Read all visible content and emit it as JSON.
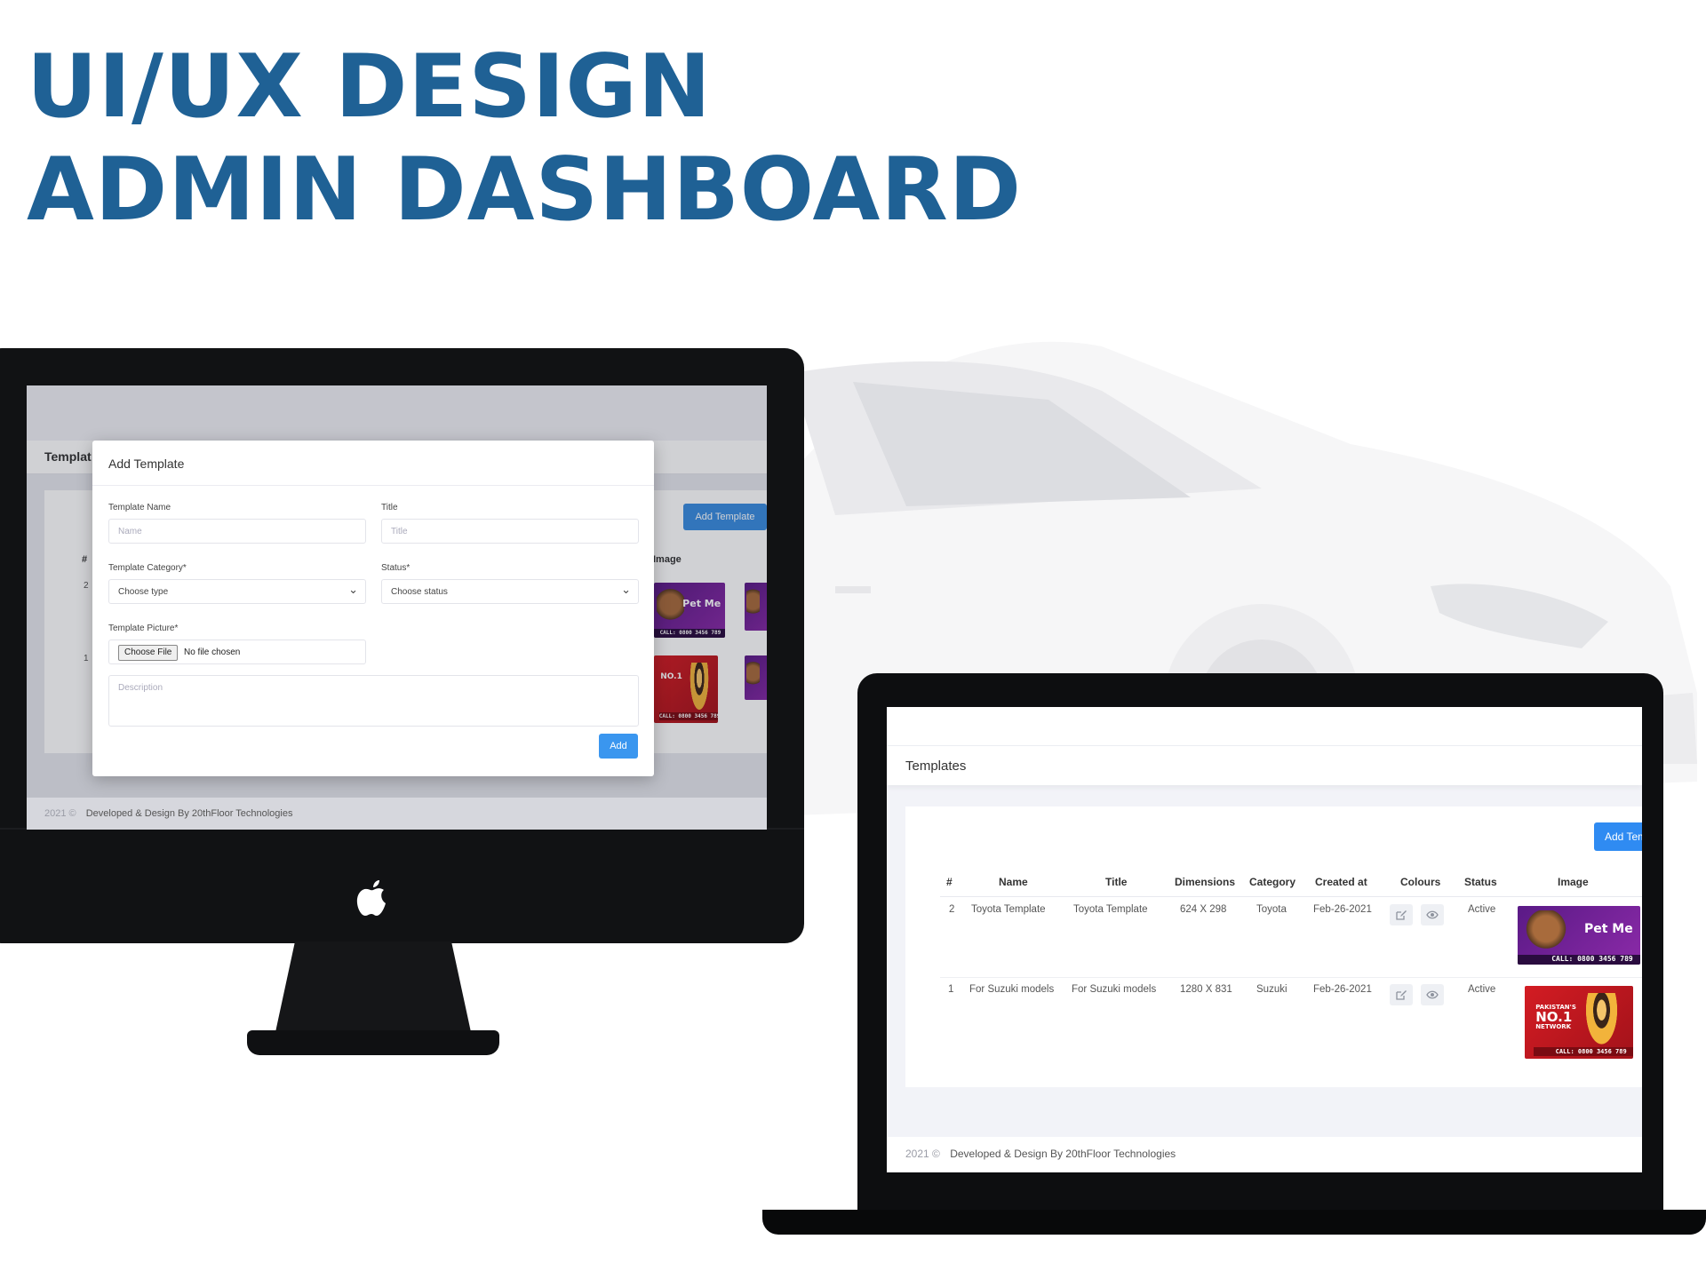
{
  "headline": {
    "line1": "UI/UX DESIGN",
    "line2": "ADMIN DASHBOARD"
  },
  "colors": {
    "headline": "#1f6195",
    "primary_button": "#3a96ef",
    "sidebar": "#23262f"
  },
  "monitor": {
    "page_title": "Templat",
    "add_template_label": "Add Template",
    "table_image_header": "Image",
    "table_hash_header": "#",
    "row_numbers": [
      "2",
      "1"
    ],
    "footer_year": "2021 ©",
    "footer_text": "Developed & Design By 20thFloor Technologies",
    "modal": {
      "title": "Add Template",
      "template_name_label": "Template Name",
      "template_name_placeholder": "Name",
      "title_label": "Title",
      "title_placeholder": "Title",
      "category_label": "Template Category*",
      "category_value": "Choose type",
      "status_label": "Status*",
      "status_value": "Choose status",
      "picture_label": "Template Picture*",
      "choose_file_label": "Choose File",
      "no_file_text": "No file chosen",
      "description_placeholder": "Description",
      "add_button": "Add"
    }
  },
  "laptop": {
    "page_title": "Templates",
    "add_button": "Add Template",
    "columns": [
      "#",
      "Name",
      "Title",
      "Dimensions",
      "Category",
      "Created at",
      "Colours",
      "Status",
      "Image"
    ],
    "rows": [
      {
        "id": "2",
        "name": "Toyota Template",
        "title": "Toyota Template",
        "dimensions": "624 X 298",
        "category": "Toyota",
        "created_at": "Feb-26-2021",
        "status": "Active",
        "image": "pet-me-ad"
      },
      {
        "id": "1",
        "name": "For Suzuki models",
        "title": "For Suzuki models",
        "dimensions": "1280 X 831",
        "category": "Suzuki",
        "created_at": "Feb-26-2021",
        "status": "Active",
        "image": "jazz-no1-network-ad"
      }
    ],
    "footer_year": "2021 ©",
    "footer_text": "Developed & Design By 20thFloor Technologies"
  },
  "ad_images": {
    "pet_me": {
      "brand": "Pet Me",
      "phone": "CALL: 0800 3456 789"
    },
    "jazz": {
      "line1": "PAKISTAN'S",
      "line2": "NO.1",
      "line3": "NETWORK",
      "phone": "CALL: 0800 3456 789"
    }
  },
  "icons": [
    "apple-logo-icon",
    "edit-icon",
    "eye-icon",
    "chevron-down-icon"
  ]
}
